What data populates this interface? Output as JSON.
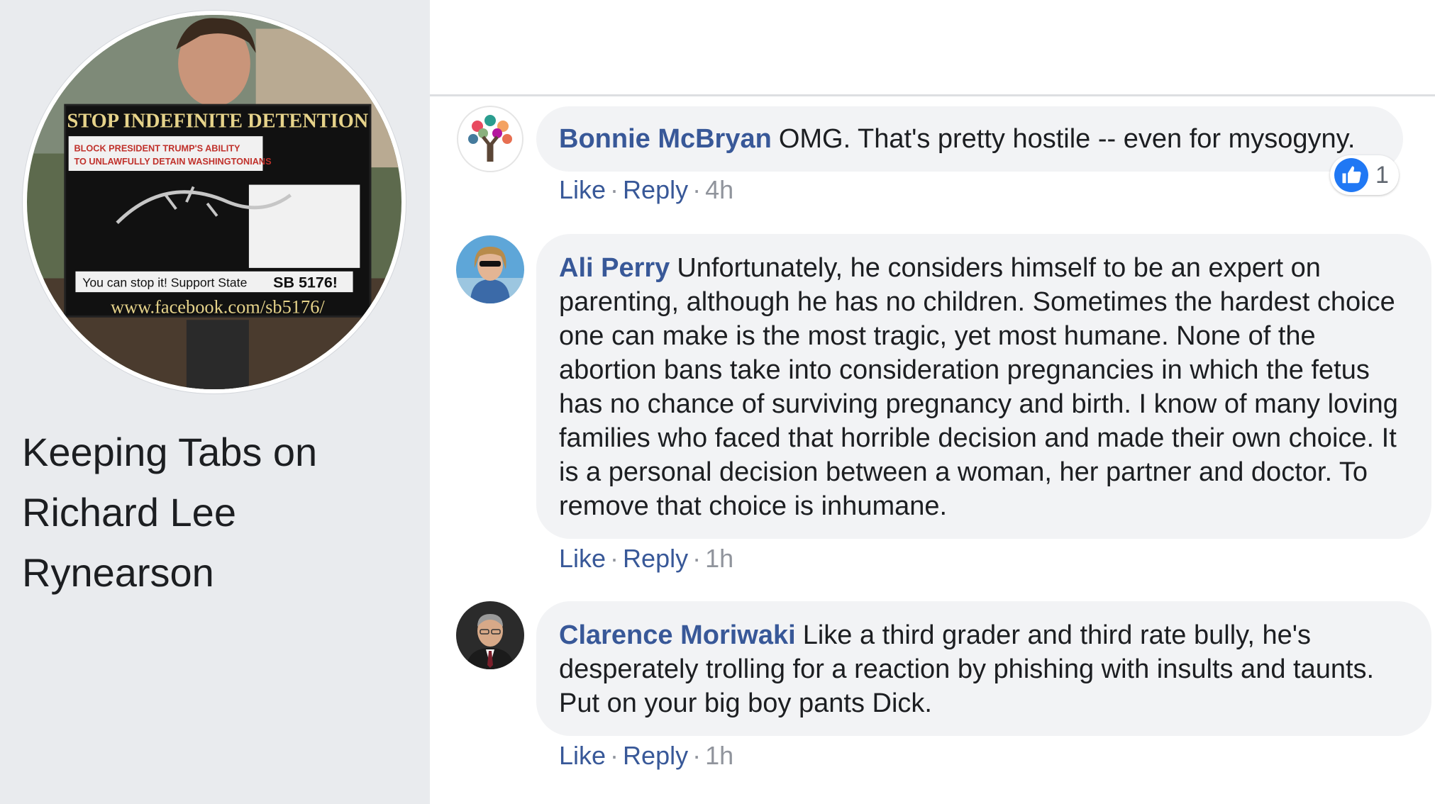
{
  "page": {
    "name": "Keeping Tabs on Richard Lee Rynearson",
    "profile_sign": {
      "headline": "STOP INDEFINITE DETENTION",
      "subhead_line1": "BLOCK PRESIDENT TRUMP'S ABILITY",
      "subhead_line2": "TO UNLAWFULLY DETAIN WASHINGTONIANS",
      "support_text": "You can stop it! Support State",
      "bill": "SB 5176!",
      "url": "www.facebook.com/sb5176/"
    }
  },
  "actions": {
    "like": "Like",
    "reply": "Reply",
    "dot": "·"
  },
  "comments": [
    {
      "author": "Bonnie McBryan",
      "text": "OMG. That's pretty hostile -- even for mysogyny.",
      "time": "4h",
      "reaction_count": "1"
    },
    {
      "author": "Ali Perry",
      "text": "Unfortunately, he considers himself to be an expert on parenting, although he has no children. Sometimes the hardest choice one can make is the most tragic, yet most humane. None of the abortion bans take into consideration pregnancies in which the fetus has no chance of surviving pregnancy and birth. I know of many loving families who faced that horrible decision and made their own choice. It is a personal decision between a woman, her partner and doctor. To remove that choice is inhumane.",
      "time": "1h"
    },
    {
      "author": "Clarence Moriwaki",
      "text": "Like a third grader and third rate bully, he's desperately trolling for a reaction by phishing with insults and taunts. Put on your big boy pants Dick.",
      "time": "1h"
    }
  ],
  "colors": {
    "link": "#385898",
    "bubble": "#f2f3f5",
    "sidebar": "#e9ebee",
    "like_blue": "#2078f4",
    "meta_gray": "#90949c"
  }
}
